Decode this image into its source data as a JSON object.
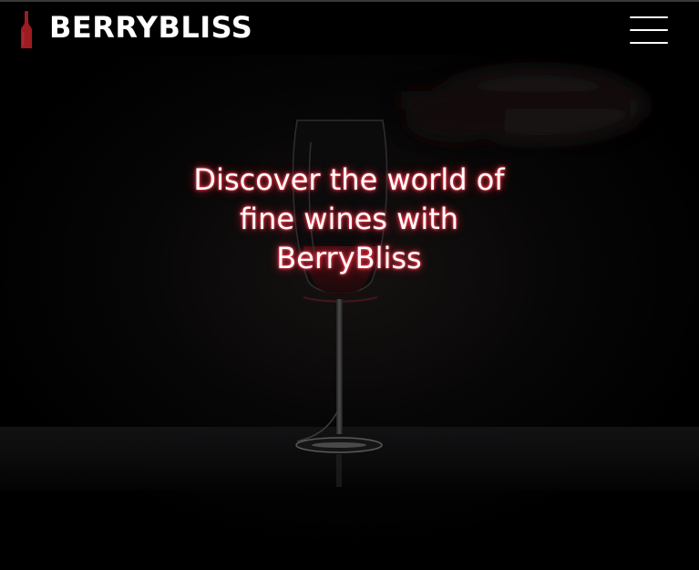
{
  "header": {
    "brand_name": "BERRYBLISS",
    "logo_icon": "wine-bottle-icon",
    "menu_icon": "hamburger-menu-icon"
  },
  "hero": {
    "headline": "Discover the world of fine wines with BerryBliss",
    "background_icon": "wine-glass-photo"
  },
  "colors": {
    "background": "#000000",
    "text": "#ffffff",
    "accent_wine": "#9e1b22",
    "headline_glow": "#ff3b4e"
  }
}
